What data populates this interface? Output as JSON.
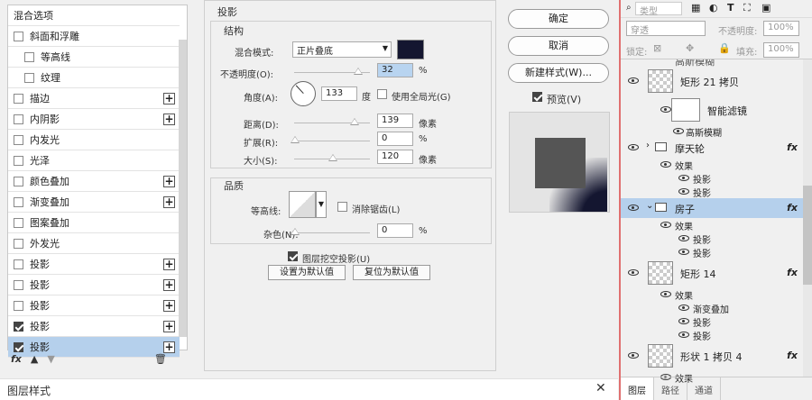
{
  "dialog": {
    "title": "图层样式",
    "styles_header": "混合选项",
    "style_items": [
      {
        "label": "斜面和浮雕",
        "checked": false,
        "plus": false,
        "indent": false
      },
      {
        "label": "等高线",
        "checked": false,
        "plus": false,
        "indent": true
      },
      {
        "label": "纹理",
        "checked": false,
        "plus": false,
        "indent": true
      },
      {
        "label": "描边",
        "checked": false,
        "plus": true,
        "indent": false
      },
      {
        "label": "内阴影",
        "checked": false,
        "plus": true,
        "indent": false
      },
      {
        "label": "内发光",
        "checked": false,
        "plus": false,
        "indent": false
      },
      {
        "label": "光泽",
        "checked": false,
        "plus": false,
        "indent": false
      },
      {
        "label": "颜色叠加",
        "checked": false,
        "plus": true,
        "indent": false
      },
      {
        "label": "渐变叠加",
        "checked": false,
        "plus": true,
        "indent": false
      },
      {
        "label": "图案叠加",
        "checked": false,
        "plus": false,
        "indent": false
      },
      {
        "label": "外发光",
        "checked": false,
        "plus": false,
        "indent": false
      },
      {
        "label": "投影",
        "checked": false,
        "plus": true,
        "indent": false
      },
      {
        "label": "投影",
        "checked": false,
        "plus": true,
        "indent": false
      },
      {
        "label": "投影",
        "checked": false,
        "plus": true,
        "indent": false
      },
      {
        "label": "投影",
        "checked": true,
        "plus": true,
        "indent": false
      },
      {
        "label": "投影",
        "checked": true,
        "plus": true,
        "indent": false,
        "selected": true
      }
    ],
    "bottom_fx": "fx",
    "section_title": "投影",
    "structure_title": "结构",
    "blend_mode_label": "混合模式:",
    "blend_mode_value": "正片叠底",
    "shadow_color": "#141630",
    "opacity_label": "不透明度(O):",
    "opacity_value": "32",
    "opacity_unit": "%",
    "angle_label": "角度(A):",
    "angle_value": "133",
    "angle_unit": "度",
    "global_light_label": "使用全局光(G)",
    "distance_label": "距离(D):",
    "distance_value": "139",
    "distance_unit": "像素",
    "spread_label": "扩展(R):",
    "spread_value": "0",
    "spread_unit": "%",
    "size_label": "大小(S):",
    "size_value": "120",
    "size_unit": "像素",
    "quality_title": "品质",
    "contour_label": "等高线:",
    "antialias_label": "消除锯齿(L)",
    "noise_label": "杂色(N):",
    "noise_value": "0",
    "noise_unit": "%",
    "knockout_label": "图层挖空投影(U)",
    "set_default": "设置为默认值",
    "reset_default": "复位为默认值",
    "ok": "确定",
    "cancel": "取消",
    "new_style": "新建样式(W)...",
    "preview_label": "预览(V)",
    "close": "✕"
  },
  "layers": {
    "filter_kind": "类型",
    "blend": "穿透",
    "opacity_label": "不透明度:",
    "opacity_value": "100%",
    "lock_label": "锁定:",
    "fill_label": "填充:",
    "fill_value": "100%",
    "top_partial": "高斯模糊",
    "rows": [
      {
        "name": "矩形 21 拷贝",
        "type": "layer",
        "fx": false
      },
      {
        "name": "智能滤镜",
        "type": "filter"
      },
      {
        "name": "高斯模糊",
        "type": "filter-item"
      },
      {
        "name": "摩天轮",
        "type": "group",
        "fx": true
      },
      {
        "name": "效果",
        "type": "effects"
      },
      {
        "name": "投影",
        "type": "effect"
      },
      {
        "name": "投影",
        "type": "effect"
      },
      {
        "name": "房子",
        "type": "group-selected",
        "fx": true
      },
      {
        "name": "效果",
        "type": "effects"
      },
      {
        "name": "投影",
        "type": "effect"
      },
      {
        "name": "投影",
        "type": "effect"
      },
      {
        "name": "矩形 14",
        "type": "layer",
        "fx": true
      },
      {
        "name": "效果",
        "type": "effects"
      },
      {
        "name": "渐变叠加",
        "type": "effect"
      },
      {
        "name": "投影",
        "type": "effect"
      },
      {
        "name": "投影",
        "type": "effect"
      },
      {
        "name": "形状 1 拷贝 4",
        "type": "layer",
        "fx": true
      },
      {
        "name": "效果",
        "type": "effects"
      }
    ],
    "tabs": [
      "图层",
      "路径",
      "通道"
    ]
  }
}
